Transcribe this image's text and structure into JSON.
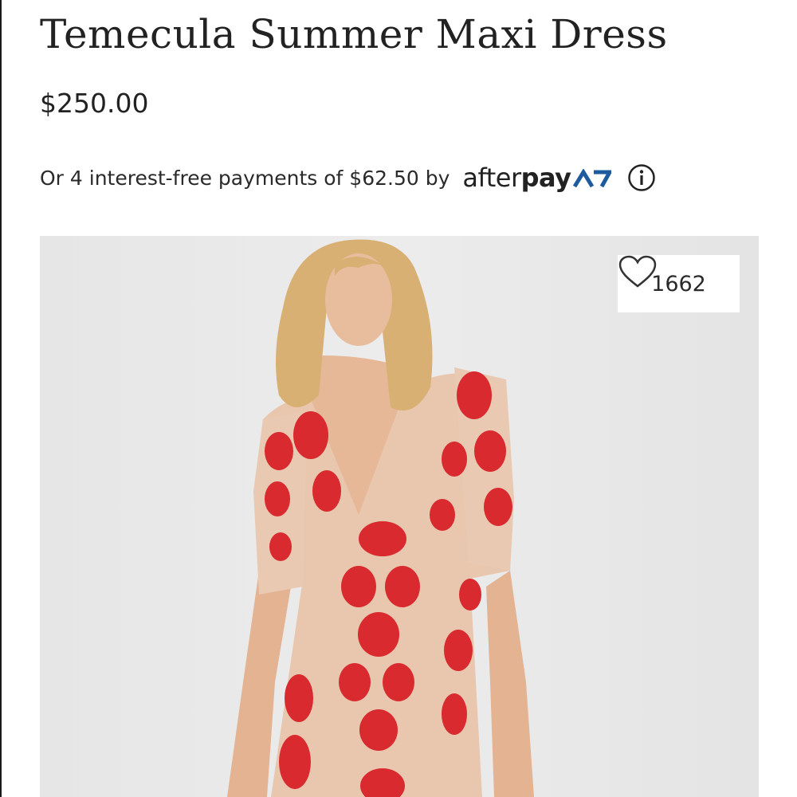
{
  "product": {
    "title": "Temecula Summer Maxi Dress",
    "price": "$250.00",
    "installments_text": "Or 4 interest-free payments of $62.50 by",
    "afterpay": {
      "word_light": "after",
      "word_bold": "pay",
      "mark_color": "#1e5a9e",
      "icon": "afterpay-logo"
    },
    "info_icon": "info-circle-icon"
  },
  "gallery": {
    "image_subject": "model wearing nude mesh dress with red floral embroidery",
    "like_count": "1662",
    "like_icon": "heart-outline-icon"
  },
  "colors": {
    "text": "#222222",
    "embroidery_red": "#d92a2f",
    "dress_nude": "#e9c7ae",
    "background_gray": "#e8e8e8"
  }
}
